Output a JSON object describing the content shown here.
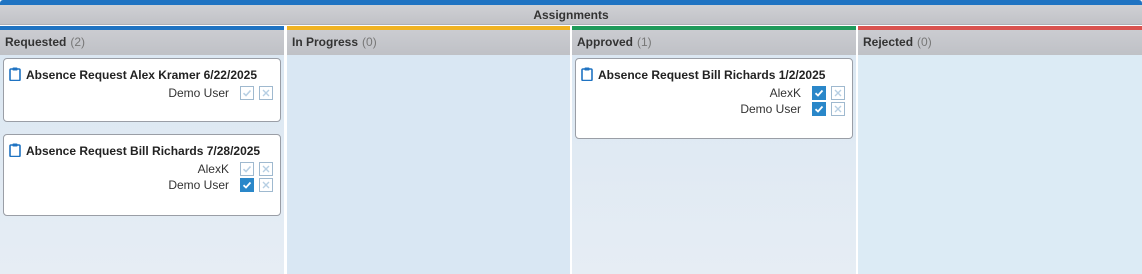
{
  "board": {
    "title": "Assignments",
    "colors": {
      "accent": "#1f73c2",
      "in_progress": "#f0b323",
      "approved": "#1f9a5a",
      "rejected": "#d9534f",
      "checked": "#2a87c9"
    }
  },
  "columns": [
    {
      "name": "Requested",
      "count": "(2)",
      "cards": [
        {
          "icon": "clipboard-icon",
          "title": "Absence Request Alex Kramer 6/22/2025",
          "assignees": [
            {
              "name": "Demo User",
              "approved": false,
              "rejected": false
            }
          ]
        },
        {
          "icon": "clipboard-icon",
          "title": "Absence Request Bill Richards 7/28/2025",
          "assignees": [
            {
              "name": "AlexK",
              "approved": false,
              "rejected": false
            },
            {
              "name": "Demo User",
              "approved": true,
              "rejected": false
            }
          ]
        }
      ]
    },
    {
      "name": "In Progress",
      "count": "(0)",
      "cards": []
    },
    {
      "name": "Approved",
      "count": "(1)",
      "cards": [
        {
          "icon": "clipboard-icon",
          "title": "Absence Request Bill Richards 1/2/2025",
          "assignees": [
            {
              "name": "AlexK",
              "approved": true,
              "rejected": false
            },
            {
              "name": "Demo User",
              "approved": true,
              "rejected": false
            }
          ]
        }
      ]
    },
    {
      "name": "Rejected",
      "count": "(0)",
      "cards": []
    }
  ]
}
